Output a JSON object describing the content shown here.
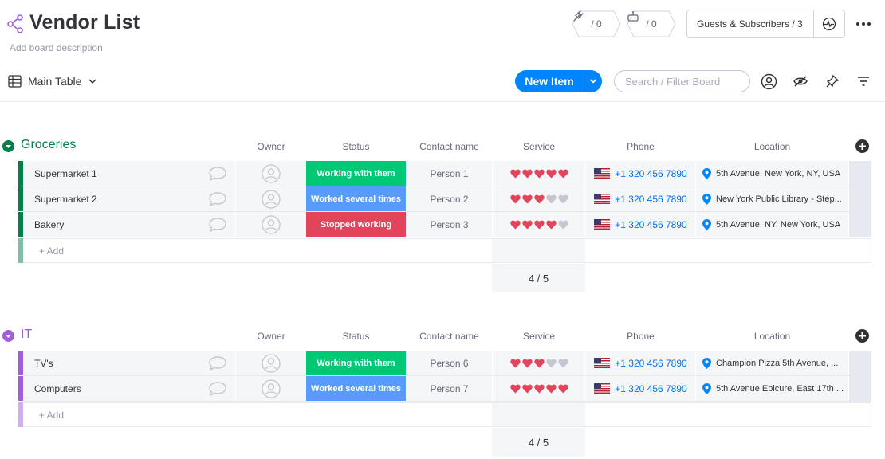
{
  "board": {
    "title": "Vendor List",
    "description": "Add board description",
    "activity_count": "/ 0",
    "integrations_count": "/ 0",
    "guests_label": "Guests & Subscribers / 3"
  },
  "toolbar": {
    "view_label": "Main Table",
    "new_item_label": "New Item",
    "search_placeholder": "Search / Filter Board"
  },
  "columns": [
    "Owner",
    "Status",
    "Contact name",
    "Service",
    "Phone",
    "Location"
  ],
  "colors": {
    "groceries": "#037f4c",
    "groceries_light": "#81bfa5",
    "it": "#a25ddc",
    "it_light": "#d0aeed",
    "status_working": "#00c875",
    "status_several": "#579bfc",
    "status_stopped": "#e2445c",
    "heart_full": "#e2445c",
    "heart_empty": "#c5c7d0"
  },
  "groups": [
    {
      "title": "Groceries",
      "add_label": "+ Add",
      "summary": "4 / 5",
      "rows": [
        {
          "name": "Supermarket 1",
          "status": "Working with them",
          "status_color": "#00c875",
          "contact": "Person 1",
          "service_rating": 5,
          "phone": "+1 320 456 7890",
          "location": "5th Avenue, New York, NY, USA"
        },
        {
          "name": "Supermarket 2",
          "status": "Worked several times",
          "status_color": "#579bfc",
          "contact": "Person 2",
          "service_rating": 3,
          "phone": "+1 320 456 7890",
          "location": "New York Public Library - Step..."
        },
        {
          "name": "Bakery",
          "status": "Stopped working",
          "status_color": "#e2445c",
          "contact": "Person 3",
          "service_rating": 4,
          "phone": "+1 320 456 7890",
          "location": "5th Avenue, NY, New York, USA"
        }
      ]
    },
    {
      "title": "IT",
      "add_label": "+ Add",
      "summary": "4 / 5",
      "rows": [
        {
          "name": "TV's",
          "status": "Working with them",
          "status_color": "#00c875",
          "contact": "Person 6",
          "service_rating": 3,
          "phone": "+1 320 456 7890",
          "location": "Champion Pizza 5th Avenue, ..."
        },
        {
          "name": "Computers",
          "status": "Worked several times",
          "status_color": "#579bfc",
          "contact": "Person 7",
          "service_rating": 5,
          "phone": "+1 320 456 7890",
          "location": "5th Avenue Epicure, East 17th ..."
        }
      ]
    }
  ]
}
